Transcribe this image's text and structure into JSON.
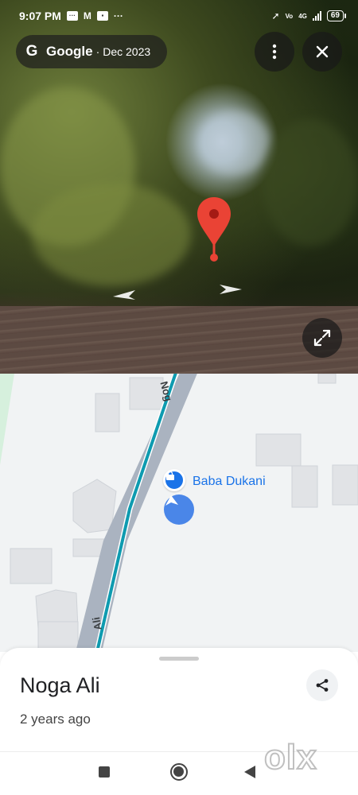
{
  "status_bar": {
    "time": "9:07 PM",
    "network": "4G",
    "battery": "69"
  },
  "street_view": {
    "brand": "Google",
    "separator": "·",
    "date": "Dec 2023",
    "icons": {
      "google": "google-g-icon",
      "more": "more-vert-icon",
      "close": "close-icon",
      "expand": "expand-icon",
      "pin": "map-pin-icon"
    },
    "pin_color": "#ea4335"
  },
  "map": {
    "road_label_top": "Nog",
    "road_label_bottom": "Ali",
    "poi_name": "Baba Dukani",
    "accent": "#1a73e8",
    "route_color": "#0e9bb0"
  },
  "place": {
    "name": "Noga Ali",
    "subtitle": "2 years ago",
    "share_icon": "share-icon"
  },
  "nav": {
    "recent": "recent-apps-icon",
    "home": "home-icon",
    "back": "back-icon"
  },
  "watermark": "olx"
}
